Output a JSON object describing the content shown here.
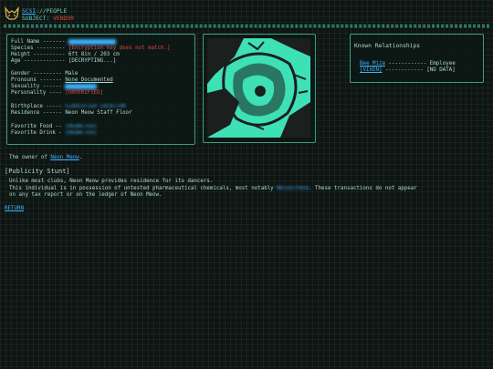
{
  "header": {
    "path_link": "SCSI",
    "path_rest": "://PEOPLE",
    "subject_label": "SUBJECT: ",
    "subject_value": "VENDOR"
  },
  "profile": {
    "full_name": {
      "label": "Full Name -------",
      "value": "CLASSIFIED NAME"
    },
    "species": {
      "label": "Species ---------",
      "value": "[Encryption key does not match.]"
    },
    "height": {
      "label": "Height ----------",
      "value": "6ft 8in / 203 cm"
    },
    "age": {
      "label": "Age -------------",
      "value": "[DECRYPTING...]"
    },
    "gender": {
      "label": "Gender ---------",
      "value": "Male"
    },
    "pronouns": {
      "label": "Pronouns -------",
      "value": "None Documented"
    },
    "sexuality": {
      "label": "Sexuality ------",
      "value": "UNVERIFIED"
    },
    "personality": {
      "label": "Personality ----",
      "value": "[UNVERIFIED]"
    },
    "birthplace": {
      "label": "Birthplace -----",
      "value": "CLASSIFIED LOCATION"
    },
    "residence": {
      "label": "Residence ------",
      "value": "Neon Meow Staff Floor"
    },
    "favorite_food": {
      "label": "Favorite Food --",
      "value": "[REDACTED]"
    },
    "favorite_drink": {
      "label": "Favorite Drink -",
      "value": "[REDACTED]"
    }
  },
  "relationships": {
    "title": "Known Relationships",
    "items": [
      {
        "name": "Bee Miza",
        "dashes": " ------------ ",
        "relation": "Employee"
      },
      {
        "name": "[VIXEN]",
        "dashes": " ------------ ",
        "relation": "[NO DATA]"
      }
    ]
  },
  "owner": {
    "prefix": "The owner of ",
    "link": "Neon Meow",
    "suffix": "."
  },
  "publicity": {
    "title": "[Publicity Stunt]",
    "line1": "Unlike most clubs, Neon Meow provides residence for its dancers.",
    "line2_pre": "This individual is in possession of untested pharmaceutical chemicals, most notably ",
    "line2_redacted": "Meloxifene",
    "line2_post": ". These transactions do not appear",
    "line3": "on any tax report or on the ledger of Neon Meow."
  },
  "return_label": "RETURN",
  "colors": {
    "accent": "#3ec9a6",
    "link": "#3fb3ff",
    "warning": "#e0453c",
    "background": "#0e1513"
  }
}
